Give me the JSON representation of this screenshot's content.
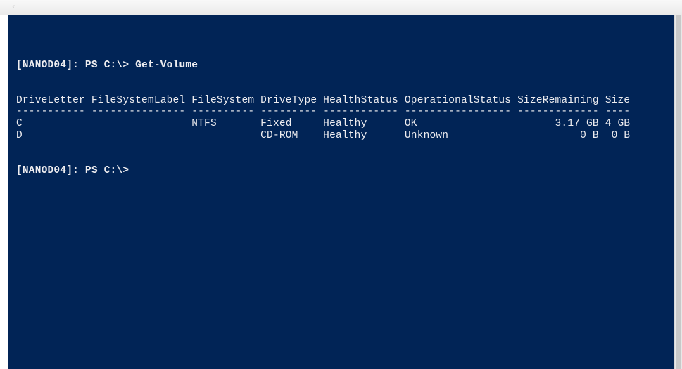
{
  "titlebar": {
    "back_icon": "‹"
  },
  "terminal": {
    "prompt1_host": "[NANOD04]: PS C:\\> ",
    "command1": "Get-Volume",
    "headers": "DriveLetter FileSystemLabel FileSystem DriveType HealthStatus OperationalStatus SizeRemaining Size",
    "separator": "----------- --------------- ---------- --------- ------------ ----------------- ------------- ----",
    "rows": [
      "C                           NTFS       Fixed     Healthy      OK                      3.17 GB 4 GB",
      "D                                      CD-ROM    Healthy      Unknown                     0 B  0 B"
    ],
    "prompt2": "[NANOD04]: PS C:\\>"
  },
  "chart_data": {
    "type": "table",
    "title": "Get-Volume",
    "columns": [
      "DriveLetter",
      "FileSystemLabel",
      "FileSystem",
      "DriveType",
      "HealthStatus",
      "OperationalStatus",
      "SizeRemaining",
      "Size"
    ],
    "data": [
      {
        "DriveLetter": "C",
        "FileSystemLabel": "",
        "FileSystem": "NTFS",
        "DriveType": "Fixed",
        "HealthStatus": "Healthy",
        "OperationalStatus": "OK",
        "SizeRemaining": "3.17 GB",
        "Size": "4 GB"
      },
      {
        "DriveLetter": "D",
        "FileSystemLabel": "",
        "FileSystem": "",
        "DriveType": "CD-ROM",
        "HealthStatus": "Healthy",
        "OperationalStatus": "Unknown",
        "SizeRemaining": "0 B",
        "Size": "0 B"
      }
    ]
  }
}
